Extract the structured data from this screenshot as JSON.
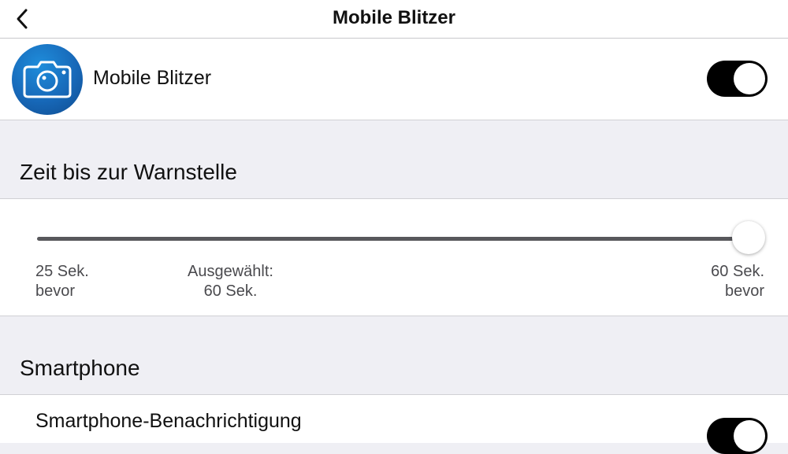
{
  "navbar": {
    "title": "Mobile Blitzer",
    "back_icon": "chevron-left-icon"
  },
  "main_row": {
    "icon": "camera-icon",
    "label": "Mobile Blitzer",
    "toggle_on": true,
    "accent_color": "#000000"
  },
  "warning_time": {
    "header": "Zeit bis zur Warnstelle",
    "slider": {
      "min_label_line1": "25 Sek.",
      "min_label_line2": "bevor",
      "selected_label_line1": "Ausgewählt:",
      "selected_label_line2": "60 Sek.",
      "max_label_line1": "60 Sek.",
      "max_label_line2": "bevor",
      "min": 25,
      "max": 60,
      "value": 60
    }
  },
  "smartphone": {
    "header": "Smartphone",
    "notification_label": "Smartphone-Benachrichtigung",
    "notification_toggle_on": true
  },
  "colors": {
    "background": "#efeff4",
    "card": "#ffffff",
    "icon_blue": "#1768b8"
  }
}
